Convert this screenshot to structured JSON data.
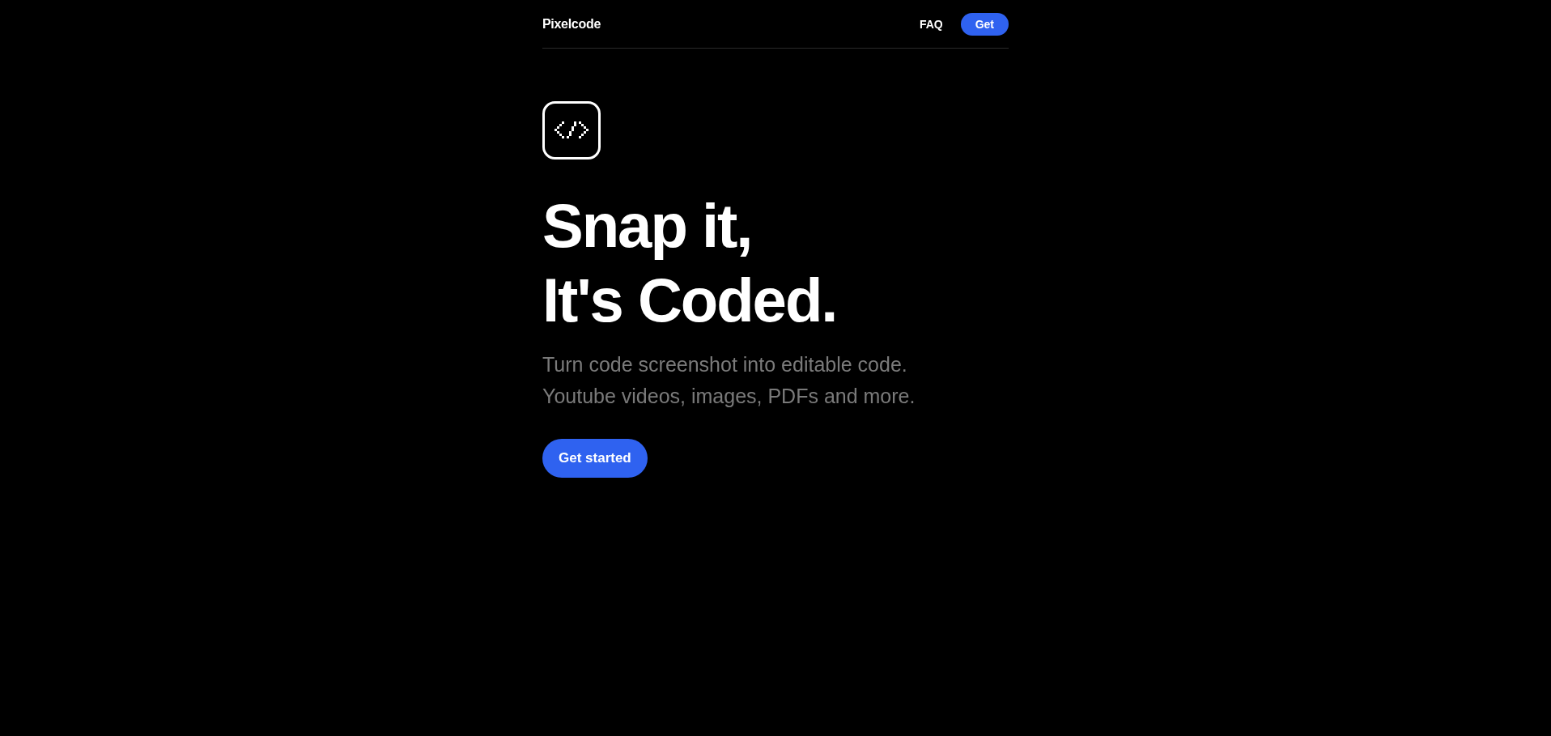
{
  "header": {
    "brand": "Pixelcode",
    "nav_links": [
      "FAQ"
    ],
    "cta": "Get"
  },
  "hero": {
    "headline_lines": [
      "Snap it,",
      "It's Coded."
    ],
    "subtitle_lines": [
      "Turn code screenshot into editable code.",
      "Youtube videos, images, PDFs and more."
    ],
    "button": "Get started"
  }
}
